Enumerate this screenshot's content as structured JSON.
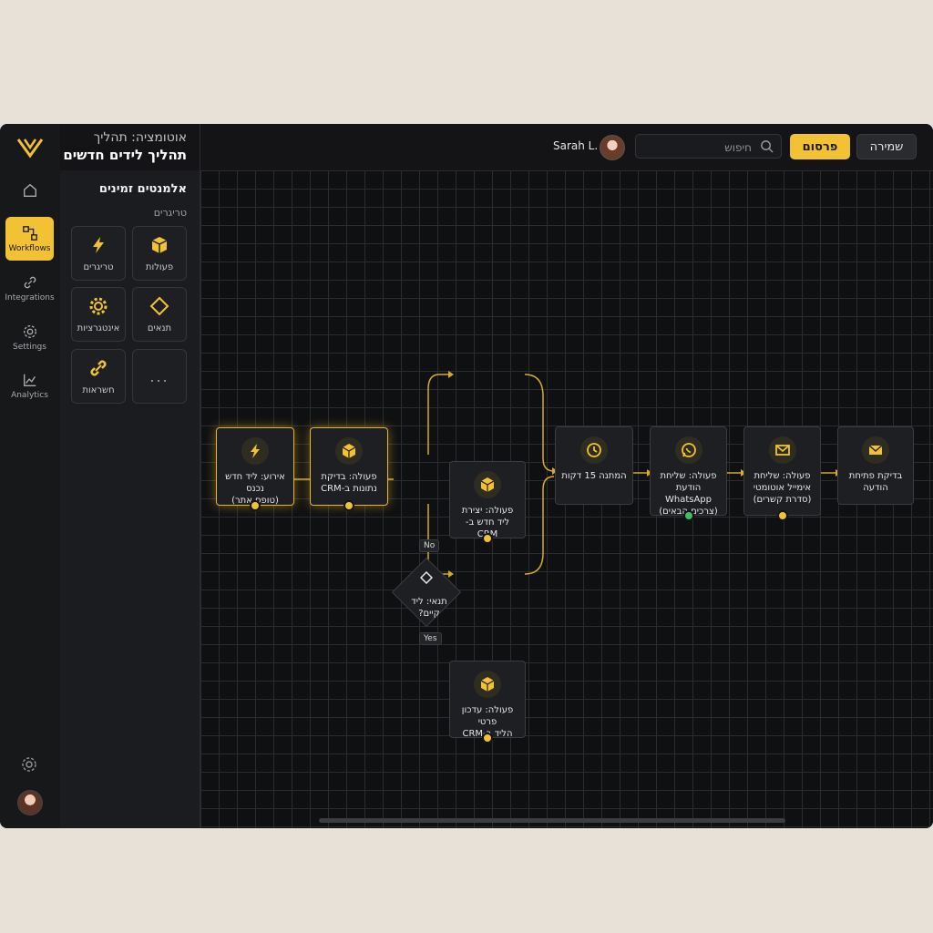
{
  "app": {
    "title_small": "אוטומציה: תהליך",
    "title_main": "תהליך לידים חדשים"
  },
  "rail": {
    "items": [
      {
        "label": "",
        "icon": "home-icon"
      },
      {
        "label": "Workflows",
        "icon": "workflow-icon"
      },
      {
        "label": "Integrations",
        "icon": "link-icon"
      },
      {
        "label": "Settings",
        "icon": "gear-icon"
      },
      {
        "label": "Analytics",
        "icon": "chart-icon"
      }
    ]
  },
  "header": {
    "user_name": "Sarah L.",
    "search_placeholder": "חיפוש",
    "publish_label": "פרסום",
    "save_label": "שמירה"
  },
  "panel": {
    "title": "אלמנטים זמינים",
    "subtitle": "טריגרים",
    "tiles": [
      {
        "label": "טריגרים",
        "icon": "bolt-icon"
      },
      {
        "label": "פעולות",
        "icon": "box-icon"
      },
      {
        "label": "אינטגרציות",
        "icon": "gear-icon"
      },
      {
        "label": "תנאים",
        "icon": "diamond-icon"
      },
      {
        "label": "חשראות",
        "icon": "link-icon"
      },
      {
        "label": "...",
        "icon": "more-icon"
      }
    ]
  },
  "canvas": {
    "nodes": {
      "trigger": {
        "line1": "אירוע: ליד חדש נכנס",
        "line2": "(טופס אתר)"
      },
      "check": {
        "line1": "פעולה: בדיקת",
        "line2": "נתונות ב-CRM"
      },
      "condition": {
        "line1": "תנאי: ליד",
        "line2": "קיים?"
      },
      "create": {
        "line1": "פעולה: יצירת",
        "line2": "ליד חדש ב-CRM"
      },
      "update": {
        "line1": "פעולה: עדכון פרטי",
        "line2": "הליד ב-CRM"
      },
      "wait": {
        "line1": "המתנה 15 דקות",
        "line2": ""
      },
      "whatsapp": {
        "line1": "פעולה: שליחת",
        "line2": "הודעת WhatsApp",
        "line3": "(צרכים הבאים)"
      },
      "email": {
        "line1": "פעולה: שליחת",
        "line2": "אימייל אוטומטי",
        "line3": "(סדרת קשרים)"
      },
      "notify": {
        "line1": "בדיקת פתיחת",
        "line2": "הודעה"
      }
    },
    "branch_no": "No",
    "branch_yes": "Yes"
  },
  "colors": {
    "accent": "#f3c234",
    "background": "#141416",
    "success": "#3fbf62"
  }
}
